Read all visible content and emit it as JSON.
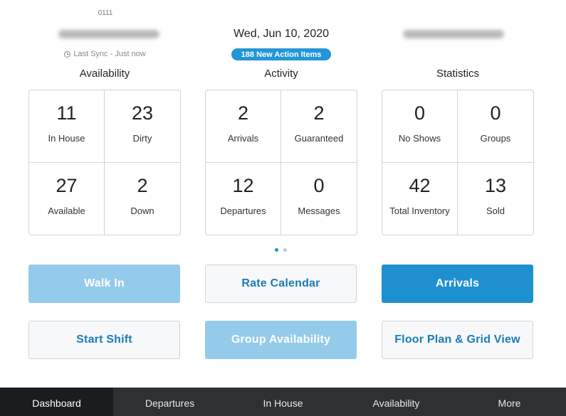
{
  "header": {
    "property_id": "0111",
    "sync_text": "Last Sync - Just now",
    "date": "Wed, Jun 10, 2020",
    "action_badge": "188 New Action Items"
  },
  "sections": {
    "availability": {
      "title": "Availability",
      "cells": [
        {
          "value": "11",
          "label": "In House"
        },
        {
          "value": "23",
          "label": "Dirty"
        },
        {
          "value": "27",
          "label": "Available"
        },
        {
          "value": "2",
          "label": "Down"
        }
      ]
    },
    "activity": {
      "title": "Activity",
      "cells": [
        {
          "value": "2",
          "label": "Arrivals"
        },
        {
          "value": "2",
          "label": "Guaranteed"
        },
        {
          "value": "12",
          "label": "Departures"
        },
        {
          "value": "0",
          "label": "Messages"
        }
      ]
    },
    "statistics": {
      "title": "Statistics",
      "cells": [
        {
          "value": "0",
          "label": "No Shows"
        },
        {
          "value": "0",
          "label": "Groups"
        },
        {
          "value": "42",
          "label": "Total Inventory"
        },
        {
          "value": "13",
          "label": "Sold"
        }
      ]
    }
  },
  "pager": {
    "pages": 2,
    "active": 1
  },
  "buttons": {
    "walk_in": "Walk In",
    "rate_calendar": "Rate Calendar",
    "arrivals": "Arrivals",
    "start_shift": "Start Shift",
    "group_availability": "Group Availability",
    "floor_plan": "Floor Plan & Grid View"
  },
  "nav": {
    "items": [
      "Dashboard",
      "Departures",
      "In House",
      "Availability",
      "More"
    ],
    "active_index": 0
  },
  "colors": {
    "accent": "#1e90d0",
    "accent_disabled": "#94cbea",
    "badge": "#2396d8",
    "nav_bg": "#2e3033"
  }
}
